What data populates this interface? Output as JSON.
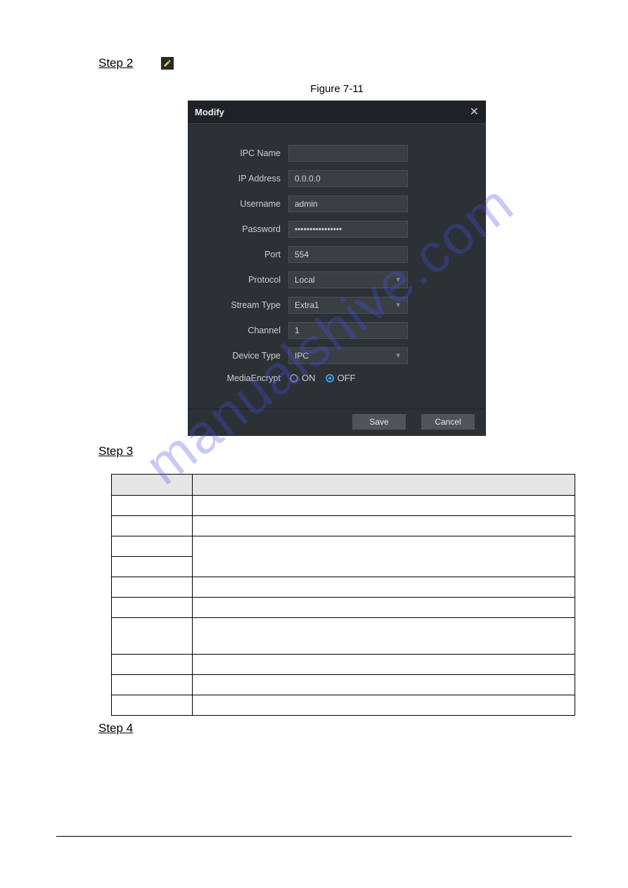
{
  "steps": {
    "s2": "Step 2",
    "s3": "Step 3",
    "s4": "Step 4"
  },
  "figure_label": "Figure 7-11",
  "dialog": {
    "title": "Modify",
    "rows": {
      "ipc_name": {
        "label": "IPC Name",
        "value": ""
      },
      "ip_address": {
        "label": "IP Address",
        "value": "0.0.0.0"
      },
      "username": {
        "label": "Username",
        "value": "admin"
      },
      "password": {
        "label": "Password",
        "value": "••••••••••••••••"
      },
      "port": {
        "label": "Port",
        "value": "554"
      },
      "protocol": {
        "label": "Protocol",
        "value": "Local"
      },
      "stream": {
        "label": "Stream Type",
        "value": "Extra1"
      },
      "channel": {
        "label": "Channel",
        "value": "1"
      },
      "device": {
        "label": "Device Type",
        "value": "IPC"
      },
      "media": {
        "label": "MediaEncrypt",
        "on": "ON",
        "off": "OFF",
        "selected": "OFF"
      }
    },
    "buttons": {
      "save": "Save",
      "cancel": "Cancel"
    }
  },
  "watermark": "manualshive.com"
}
